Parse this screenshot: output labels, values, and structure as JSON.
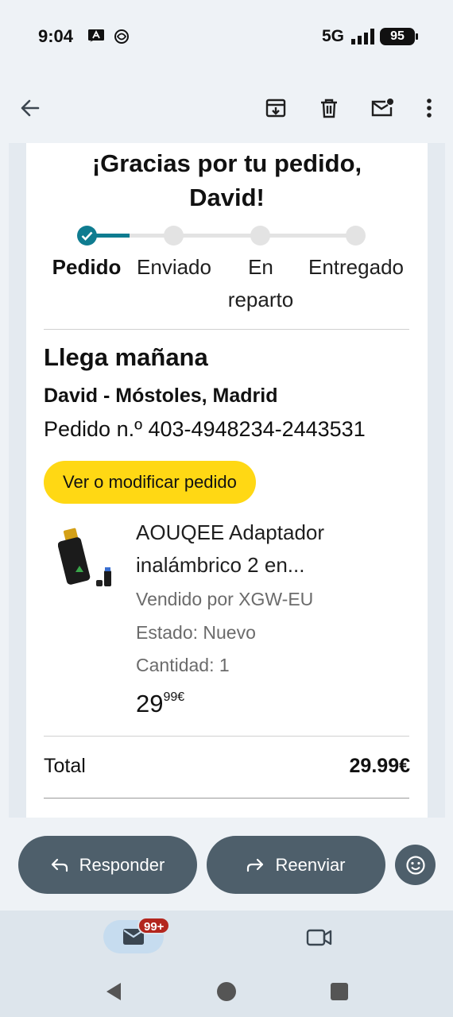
{
  "status_bar": {
    "time": "9:04",
    "network": "5G",
    "battery": "95",
    "icons": [
      "notification-a-icon",
      "signal-bars-icon",
      "battery-icon"
    ]
  },
  "app_bar": {
    "icons": [
      "back-arrow-icon",
      "archive-icon",
      "delete-icon",
      "mark-unread-icon",
      "more-vert-icon"
    ]
  },
  "email": {
    "greeting_line1": "¡Gracias por tu pedido,",
    "greeting_line2": "David!",
    "steps": [
      {
        "label": "Pedido",
        "state": "done"
      },
      {
        "label": "Enviado",
        "state": "pending"
      },
      {
        "label_line1": "En",
        "label_line2": "reparto",
        "state": "pending"
      },
      {
        "label": "Entregado",
        "state": "pending"
      }
    ],
    "progress_fraction": 0.2,
    "accent_color": "#0f7c90",
    "arrival": "Llega mañana",
    "address": "David - Móstoles, Madrid",
    "order_number": "Pedido n.º 403-4948234-2443531",
    "view_button": "Ver o modificar pedido",
    "view_button_color": "#ffd814",
    "product": {
      "title_line1": "AOUQEE Adaptador",
      "title_line2": "inalámbrico 2 en...",
      "seller": "Vendido por XGW-EU",
      "condition": "Estado: Nuevo",
      "quantity": "Cantidad: 1",
      "price_whole": "29",
      "price_fraction": "99€"
    },
    "total_label": "Total",
    "total_value": "29.99€"
  },
  "actions": {
    "reply": "Responder",
    "forward": "Reenviar",
    "emoji_icon": "emoji-reaction-icon"
  },
  "bottom_nav": {
    "mail_badge": "99+",
    "icons": [
      "mail-icon",
      "video-icon"
    ]
  },
  "system_nav": {
    "icons": [
      "back-triangle-icon",
      "home-circle-icon",
      "recents-square-icon"
    ]
  }
}
